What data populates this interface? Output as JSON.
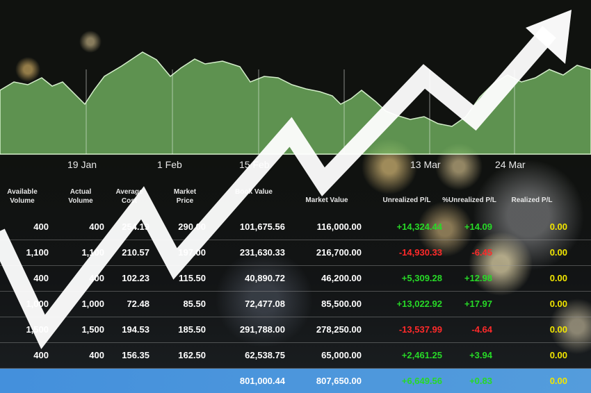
{
  "dates": [
    "19 Jan",
    "1 Feb",
    "15 Feb",
    "13 Mar",
    "24 Mar"
  ],
  "headers": [
    "Available Volume",
    "Actual Volume",
    "Average Cost",
    "Market Price",
    "Book Value",
    "Market Value",
    "Unrealized P/L",
    "%Unrealized P/L",
    "Realized P/L"
  ],
  "rows": [
    {
      "available": "400",
      "actual": "400",
      "avg": "254.19",
      "price": "290.00",
      "book": "101,675.56",
      "market": "116,000.00",
      "upl": "+14,324.44",
      "pupl": "+14.09",
      "rpl": "0.00"
    },
    {
      "available": "1,100",
      "actual": "1,100",
      "avg": "210.57",
      "price": "197.00",
      "book": "231,630.33",
      "market": "216,700.00",
      "upl": "-14,930.33",
      "pupl": "-6.45",
      "rpl": "0.00"
    },
    {
      "available": "400",
      "actual": "400",
      "avg": "102.23",
      "price": "115.50",
      "book": "40,890.72",
      "market": "46,200.00",
      "upl": "+5,309.28",
      "pupl": "+12.98",
      "rpl": "0.00"
    },
    {
      "available": "1,000",
      "actual": "1,000",
      "avg": "72.48",
      "price": "85.50",
      "book": "72,477.08",
      "market": "85,500.00",
      "upl": "+13,022.92",
      "pupl": "+17.97",
      "rpl": "0.00"
    },
    {
      "available": "1,500",
      "actual": "1,500",
      "avg": "194.53",
      "price": "185.50",
      "book": "291,788.00",
      "market": "278,250.00",
      "upl": "-13,537.99",
      "pupl": "-4.64",
      "rpl": "0.00"
    },
    {
      "available": "400",
      "actual": "400",
      "avg": "156.35",
      "price": "162.50",
      "book": "62,538.75",
      "market": "65,000.00",
      "upl": "+2,461.25",
      "pupl": "+3.94",
      "rpl": "0.00"
    }
  ],
  "totals": {
    "book": "801,000.44",
    "market": "807,650.00",
    "upl": "+6,649.56",
    "pupl": "+0.83",
    "rpl": "0.00"
  },
  "colors": {
    "positive": "#27d927",
    "negative": "#ff2a2a",
    "zero": "#f2e600",
    "chart_fill": "#7dc46a",
    "total_bar": "#4a98e6"
  }
}
